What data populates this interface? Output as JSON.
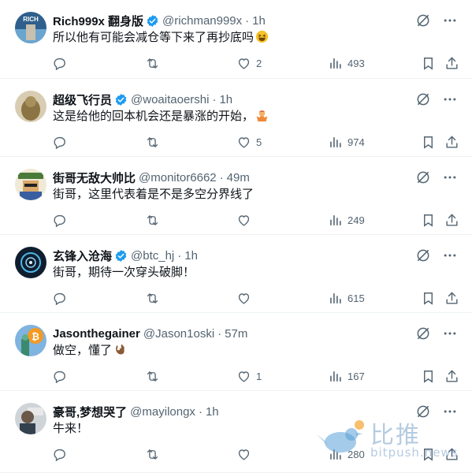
{
  "tweets": [
    {
      "name": "Rich999x 翻身版",
      "verified": true,
      "handle": "@richman999x",
      "time": "1h",
      "text": "所以他有可能会减仓等下来了再抄底吗",
      "emoji": "grinning-squint",
      "avatar": {
        "label": "RICH",
        "bg": "#3b6f9e"
      },
      "replies": "",
      "retweets": "",
      "likes": "2",
      "views": "493"
    },
    {
      "name": "超级飞行员",
      "verified": true,
      "handle": "@woaitaoershi",
      "time": "1h",
      "text": "这是给他的回本机会还是暴涨的开始，",
      "emoji": "person-shrug",
      "avatar": {
        "label": "",
        "bg": "#b9a27a"
      },
      "replies": "",
      "retweets": "",
      "likes": "5",
      "views": "974"
    },
    {
      "name": "街哥无敌大帅比",
      "verified": false,
      "handle": "@monitor6662",
      "time": "49m",
      "text": "街哥，这里代表着是不是多空分界线了",
      "emoji": "",
      "avatar": {
        "label": "",
        "bg": "#e8e2c8"
      },
      "replies": "",
      "retweets": "",
      "likes": "",
      "views": "249"
    },
    {
      "name": "玄锋入沧海",
      "verified": true,
      "handle": "@btc_hj",
      "time": "1h",
      "text": "街哥，期待一次穿头破脚！",
      "emoji": "",
      "avatar": {
        "label": "",
        "bg": "#1b2b3c"
      },
      "replies": "",
      "retweets": "",
      "likes": "",
      "views": "615"
    },
    {
      "name": "Jasonthegainer",
      "verified": false,
      "handle": "@Jason1oski",
      "time": "57m",
      "text": "做空，懂了",
      "emoji": "ok-hand",
      "avatar": {
        "label": "",
        "bg": "#f4a03a"
      },
      "replies": "",
      "retweets": "",
      "likes": "1",
      "views": "167"
    },
    {
      "name": "豪哥,梦想哭了",
      "verified": false,
      "handle": "@mayilongx",
      "time": "1h",
      "text": "牛来！",
      "emoji": "",
      "avatar": {
        "label": "",
        "bg": "#9aa3ad"
      },
      "replies": "",
      "retweets": "",
      "likes": "",
      "views": "280"
    }
  ],
  "watermark": {
    "brand": "比推",
    "site": "bitpush.news"
  },
  "colors": {
    "verified": "#1d9bf0",
    "muted": "#536471",
    "text": "#0f1419",
    "divider": "#eff3f4"
  }
}
